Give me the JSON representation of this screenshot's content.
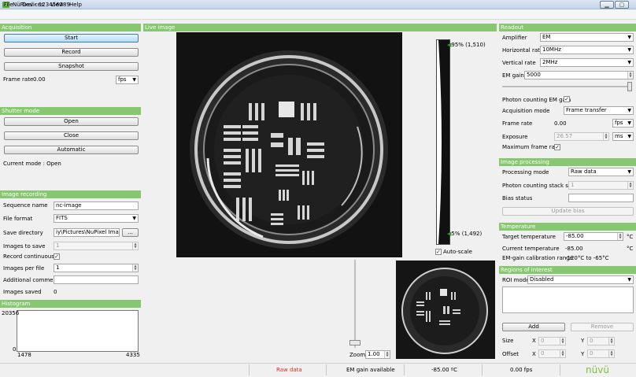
{
  "window": {
    "title": "NüPixel - 123456789",
    "icon": "nuvu-app-icon",
    "minimize": "▁",
    "restore": "▢",
    "close": "✕"
  },
  "menu": [
    "File",
    "Devices",
    "View",
    "Help"
  ],
  "acquisition": {
    "header": "Acquisition",
    "start": "Start",
    "record": "Record",
    "snapshot": "Snapshot",
    "frame_rate_label": "Frame rate",
    "frame_rate_value": "0.00",
    "frame_rate_unit": "fps"
  },
  "shutter": {
    "header": "Shutter mode",
    "open": "Open",
    "close": "Close",
    "automatic": "Automatic",
    "current_mode": "Current mode :  Open"
  },
  "recording": {
    "header": "Image recording",
    "sequence_name_label": "Sequence name",
    "sequence_name": "nc-image",
    "file_format_label": "File format",
    "file_format": "FITS",
    "save_directory_label": "Save directory",
    "save_directory": "iy\\Pictures\\NuPixel Images",
    "browse": "...",
    "images_to_save_label": "Images to save",
    "images_to_save": "1",
    "record_continuously_label": "Record continuously",
    "images_per_file_label": "Images per file",
    "images_per_file": "1",
    "additional_comment_label": "Additional comment",
    "images_saved_label": "Images saved",
    "images_saved": "0"
  },
  "histogram": {
    "header": "Histogram",
    "y_max": "20356",
    "y_min": "0",
    "x_min": "1478",
    "x_max": "4335"
  },
  "live": {
    "header": "Live image",
    "top_level": "95% (1,510)",
    "bottom_level": "5% (1,492)",
    "autoscale": "Auto-scale",
    "zoom_label": "Zoom",
    "zoom_value": "1.00"
  },
  "readout": {
    "header": "Readout",
    "amplifier_label": "Amplifier",
    "amplifier": "EM",
    "horizontal_rate_label": "Horizontal rate",
    "horizontal_rate": "10MHz",
    "vertical_rate_label": "Vertical rate",
    "vertical_rate": "2MHz",
    "em_gain_label": "EM gain",
    "em_gain": "5000",
    "photon_counting_label": "Photon counting EM gain",
    "acquisition_mode_label": "Acquisition mode",
    "acquisition_mode": "Frame transfer",
    "frame_rate_label": "Frame rate",
    "frame_rate_value": "0.00",
    "frame_rate_unit": "fps",
    "exposure_label": "Exposure",
    "exposure": "26.57",
    "exposure_unit": "ms",
    "max_frame_rate_label": "Maximum frame rate"
  },
  "processing": {
    "header": "Image processing",
    "processing_mode_label": "Processing mode",
    "processing_mode": "Raw data",
    "stack_size_label": "Photon counting stack size",
    "stack_size": "1",
    "bias_status_label": "Bias status",
    "update_bias": "Update bias"
  },
  "temperature": {
    "header": "Temperature",
    "target_label": "Target temperature",
    "target": "-85.00",
    "target_unit": "°C",
    "current_label": "Current temperature",
    "current": "-85.00",
    "current_unit": "°C",
    "calibration_label": "EM-gain calibration range",
    "calibration": "-120°C to -65°C"
  },
  "roi": {
    "header": "Regions of interest",
    "mode_label": "ROI mode",
    "mode": "Disabled",
    "add": "Add",
    "remove": "Remove",
    "size_label": "Size",
    "offset_label": "Offset",
    "x": "X",
    "y": "Y",
    "value": "0"
  },
  "status": {
    "raw_data": "Raw data",
    "em_gain": "EM gain available",
    "temperature": "-85.00 ºC",
    "fps": "0.00 fps",
    "logo": "nüvü"
  },
  "colors": {
    "header_green": "#86c76f",
    "status_red": "#e0301e",
    "logo_green": "#7fbf3f",
    "button_blue": "#b7dcf5"
  }
}
